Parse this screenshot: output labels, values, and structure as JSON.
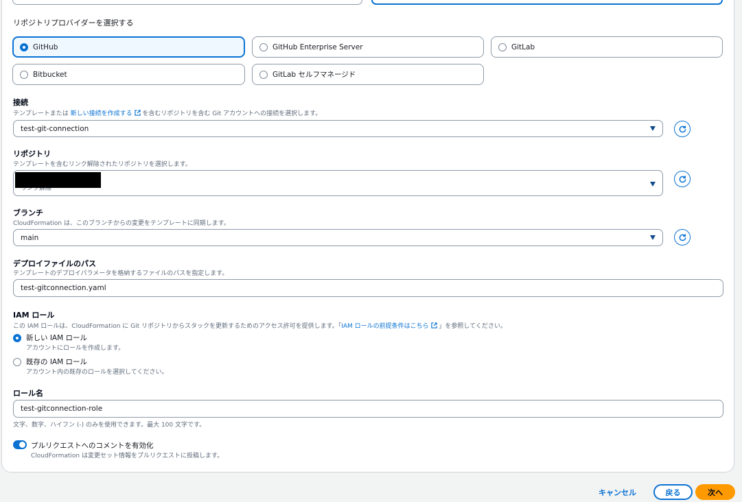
{
  "provider": {
    "label": "リポジトリプロバイダーを選択する",
    "options": [
      "GitHub",
      "GitHub Enterprise Server",
      "GitLab",
      "Bitbucket",
      "GitLab セルフマネージド"
    ],
    "selected": "GitHub"
  },
  "connection": {
    "title": "接続",
    "desc_pre": "テンプレートまたは",
    "desc_link": "新しい接続を作成する",
    "desc_post": "を含むリポジトリを含む Git アカウントへの接続を選択します。",
    "value": "test-git-connection"
  },
  "repository": {
    "title": "リポジトリ",
    "desc": "テンプレートを含むリンク解除されたリポジトリを選択します。",
    "subtext": "リンク解除"
  },
  "branch": {
    "title": "ブランチ",
    "desc": "CloudFormation は、このブランチからの変更をテンプレートに同期します。",
    "value": "main"
  },
  "deploy_file": {
    "title": "デプロイファイルのパス",
    "desc": "テンプレートのデプロイパラメータを格納するファイルのパスを指定します。",
    "value": "test-gitconnection.yaml"
  },
  "iam_role": {
    "title": "IAM ロール",
    "desc_pre": "この IAM ロールは、CloudFormation に Git リポジトリからスタックを更新するためのアクセス許可を提供します。「",
    "desc_link": "IAM ロールの前提条件はこちら",
    "desc_post": "」を参照してください。",
    "new_label": "新しい IAM ロール",
    "new_desc": "アカウントにロールを作成します。",
    "existing_label": "既存の IAM ロール",
    "existing_desc": "アカウント内の既存のロールを選択してください。",
    "selected": "new"
  },
  "role_name": {
    "title": "ロール名",
    "value": "test-gitconnection-role",
    "hint": "文字、数字、ハイフン (-) のみを使用できます。最大 100 文字です。"
  },
  "pr_comment": {
    "label": "プルリクエストへのコメントを有効化",
    "desc": "CloudFormation は変更セット情報をプルリクエストに投稿します。",
    "enabled": true
  },
  "footer": {
    "cancel": "キャンセル",
    "back": "戻る",
    "next": "次へ"
  },
  "colors": {
    "accent": "#0972d3",
    "primary_button": "#ff9900"
  }
}
